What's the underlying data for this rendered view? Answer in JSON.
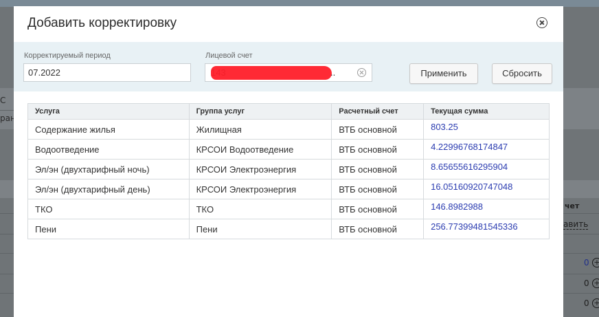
{
  "modal": {
    "title": "Добавить корректировку"
  },
  "filters": {
    "period_label": "Корректируемый период",
    "period_value": "07.2022",
    "account_label": "Лицевой счет",
    "account_value": "143",
    "account_value_suffix": "..",
    "apply_label": "Применить",
    "reset_label": "Сбросить"
  },
  "table": {
    "columns": [
      "Услуга",
      "Группа услуг",
      "Расчетный счет",
      "Текущая сумма"
    ],
    "rows": [
      {
        "service": "Содержание жилья",
        "group": "Жилищная",
        "account": "ВТБ основной",
        "amount": "803.25"
      },
      {
        "service": "Водоотведение",
        "group": "КРСОИ Водоотведение",
        "account": "ВТБ основной",
        "amount": "4.22996768174847"
      },
      {
        "service": "Эл/эн (двухтарифный ночь)",
        "group": "КРСОИ Электроэнергия",
        "account": "ВТБ основной",
        "amount": "8.65655616295904"
      },
      {
        "service": "Эл/эн (двухтарифный день)",
        "group": "КРСОИ Электроэнергия",
        "account": "ВТБ основной",
        "amount": "16.05160920747048"
      },
      {
        "service": "ТКО",
        "group": "ТКО",
        "account": "ВТБ основной",
        "amount": "146.8982988"
      },
      {
        "service": "Пени",
        "group": "Пени",
        "account": "ВТБ основной",
        "amount": "256.77399481545336"
      }
    ]
  },
  "background": {
    "left_fragment_1": "С",
    "left_fragment_2": "ран",
    "right_header": "чет",
    "right_link": "авить",
    "right_zero_1": "0",
    "right_zero_2": "0",
    "right_zero_3": "0"
  },
  "colors": {
    "link_amount": "#2a3bb0",
    "filter_panel": "#e8f1f5",
    "redaction": "#ff1f2a"
  }
}
